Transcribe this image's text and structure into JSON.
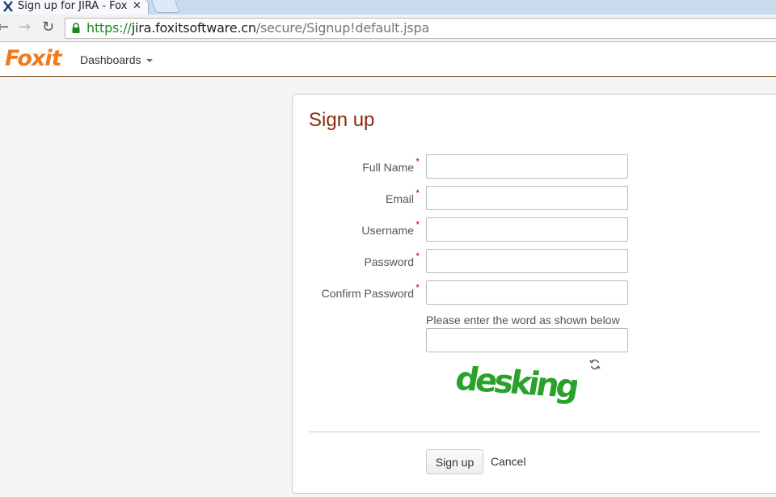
{
  "browser": {
    "tab_title": "Sign up for JIRA - Foxit",
    "tab_close": "✕",
    "url_scheme": "https://",
    "url_host": "jira.foxitsoftware.cn",
    "url_path": "/secure/Signup!default.jspa",
    "nav_back": "←",
    "nav_forward": "→",
    "nav_reload": "↻"
  },
  "header": {
    "logo_text": "Foxit",
    "nav_dashboards": "Dashboards"
  },
  "form": {
    "title": "Sign up",
    "required_marker": "*",
    "fields": [
      {
        "label": "Full Name",
        "value": ""
      },
      {
        "label": "Email",
        "value": ""
      },
      {
        "label": "Username",
        "value": ""
      },
      {
        "label": "Password",
        "value": ""
      },
      {
        "label": "Confirm Password",
        "value": ""
      }
    ],
    "captcha_hint": "Please enter the word as shown below",
    "captcha_value": "",
    "captcha_word": "desking",
    "submit_label": "Sign up",
    "cancel_label": "Cancel"
  },
  "colors": {
    "brand_orange": "#f07a1c",
    "title_red": "#8b2a0c",
    "captcha_green": "#2aa22a",
    "url_green": "#1a8a1a"
  }
}
